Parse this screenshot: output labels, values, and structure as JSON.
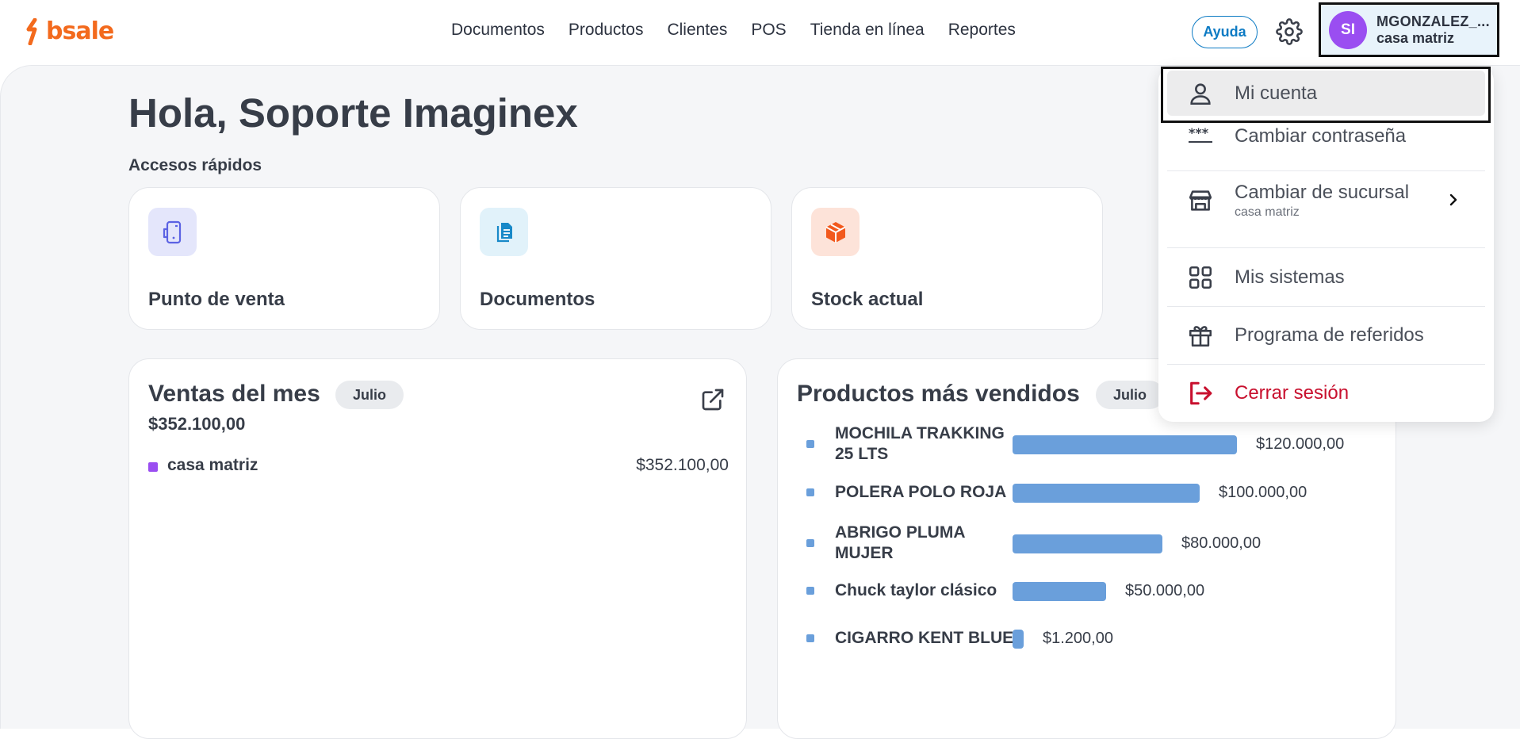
{
  "brand": {
    "name": "bsale",
    "color": "#f36a1d"
  },
  "nav": {
    "items": [
      "Documentos",
      "Productos",
      "Clientes",
      "POS",
      "Tienda en línea",
      "Reportes"
    ]
  },
  "header": {
    "help_label": "Ayuda",
    "settings_icon": "gear-icon",
    "user": {
      "initials": "SI",
      "name": "MGONZALEZ_...",
      "branch": "casa matriz",
      "avatar_color": "#9a4ef1"
    }
  },
  "main": {
    "greeting": "Hola, Soporte Imaginex",
    "quick_access_title": "Accesos rápidos",
    "quick_access": [
      {
        "label": "Punto de venta",
        "icon": "pos-device-icon",
        "icon_bg": "#e4e6fb",
        "icon_color": "#5b62e3"
      },
      {
        "label": "Documentos",
        "icon": "document-icon",
        "icon_bg": "#e1f2fa",
        "icon_color": "#1889c8"
      },
      {
        "label": "Stock actual",
        "icon": "box-icon",
        "icon_bg": "#fde3d9",
        "icon_color": "#f2591d"
      }
    ],
    "sales": {
      "title": "Ventas del mes",
      "month": "Julio",
      "total": "$352.100,00",
      "branches": [
        {
          "name": "casa matriz",
          "value": "$352.100,00",
          "color": "#9a4ef1"
        }
      ]
    },
    "top_products": {
      "title": "Productos más vendidos",
      "month": "Julio",
      "bar_color": "#6a9fdb",
      "items": [
        {
          "name_lines": [
            "MOCHILA TRAKKING",
            "25 LTS"
          ],
          "value": "$120.000,00",
          "amount": 120000
        },
        {
          "name_lines": [
            "POLERA POLO ROJA"
          ],
          "value": "$100.000,00",
          "amount": 100000
        },
        {
          "name_lines": [
            "ABRIGO PLUMA",
            "MUJER"
          ],
          "value": "$80.000,00",
          "amount": 80000
        },
        {
          "name_lines": [
            "Chuck taylor clásico"
          ],
          "value": "$50.000,00",
          "amount": 50000
        },
        {
          "name_lines": [
            "CIGARRO KENT BLUE"
          ],
          "value": "$1.200,00",
          "amount": 1200
        }
      ]
    }
  },
  "user_menu": {
    "items": [
      {
        "label": "Mi cuenta",
        "icon": "user-icon"
      },
      {
        "label": "Cambiar contraseña",
        "icon": "password-icon"
      },
      {
        "label": "Cambiar de sucursal",
        "sublabel": "casa matriz",
        "icon": "store-icon"
      },
      {
        "label": "Mis sistemas",
        "icon": "grid-icon"
      },
      {
        "label": "Programa de referidos",
        "icon": "gift-icon"
      },
      {
        "label": "Cerrar sesión",
        "icon": "logout-icon",
        "color": "#c8102e"
      }
    ]
  }
}
